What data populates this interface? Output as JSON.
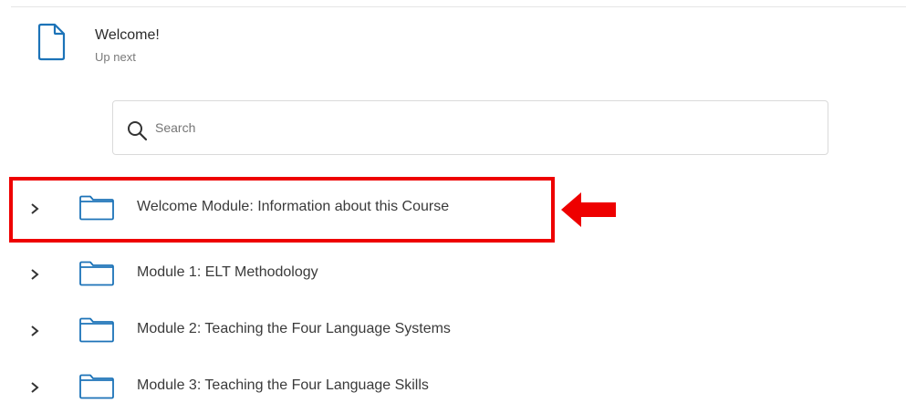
{
  "up_next": {
    "title": "Welcome!",
    "subtitle": "Up next",
    "icon": "document-icon"
  },
  "search": {
    "placeholder": "Search",
    "value": "",
    "icon": "search-icon"
  },
  "modules": [
    {
      "label": "Welcome Module: Information about this Course",
      "icon": "folder-icon",
      "highlighted": true
    },
    {
      "label": "Module 1: ELT Methodology",
      "icon": "folder-icon",
      "highlighted": false
    },
    {
      "label": "Module 2: Teaching the Four Language Systems",
      "icon": "folder-icon",
      "highlighted": false
    },
    {
      "label": "Module 3: Teaching the Four Language Skills",
      "icon": "folder-icon",
      "highlighted": false
    }
  ],
  "colors": {
    "icon_blue": "#1c73b8",
    "highlight_red": "#ee0000",
    "text": "#3a3a3a"
  }
}
